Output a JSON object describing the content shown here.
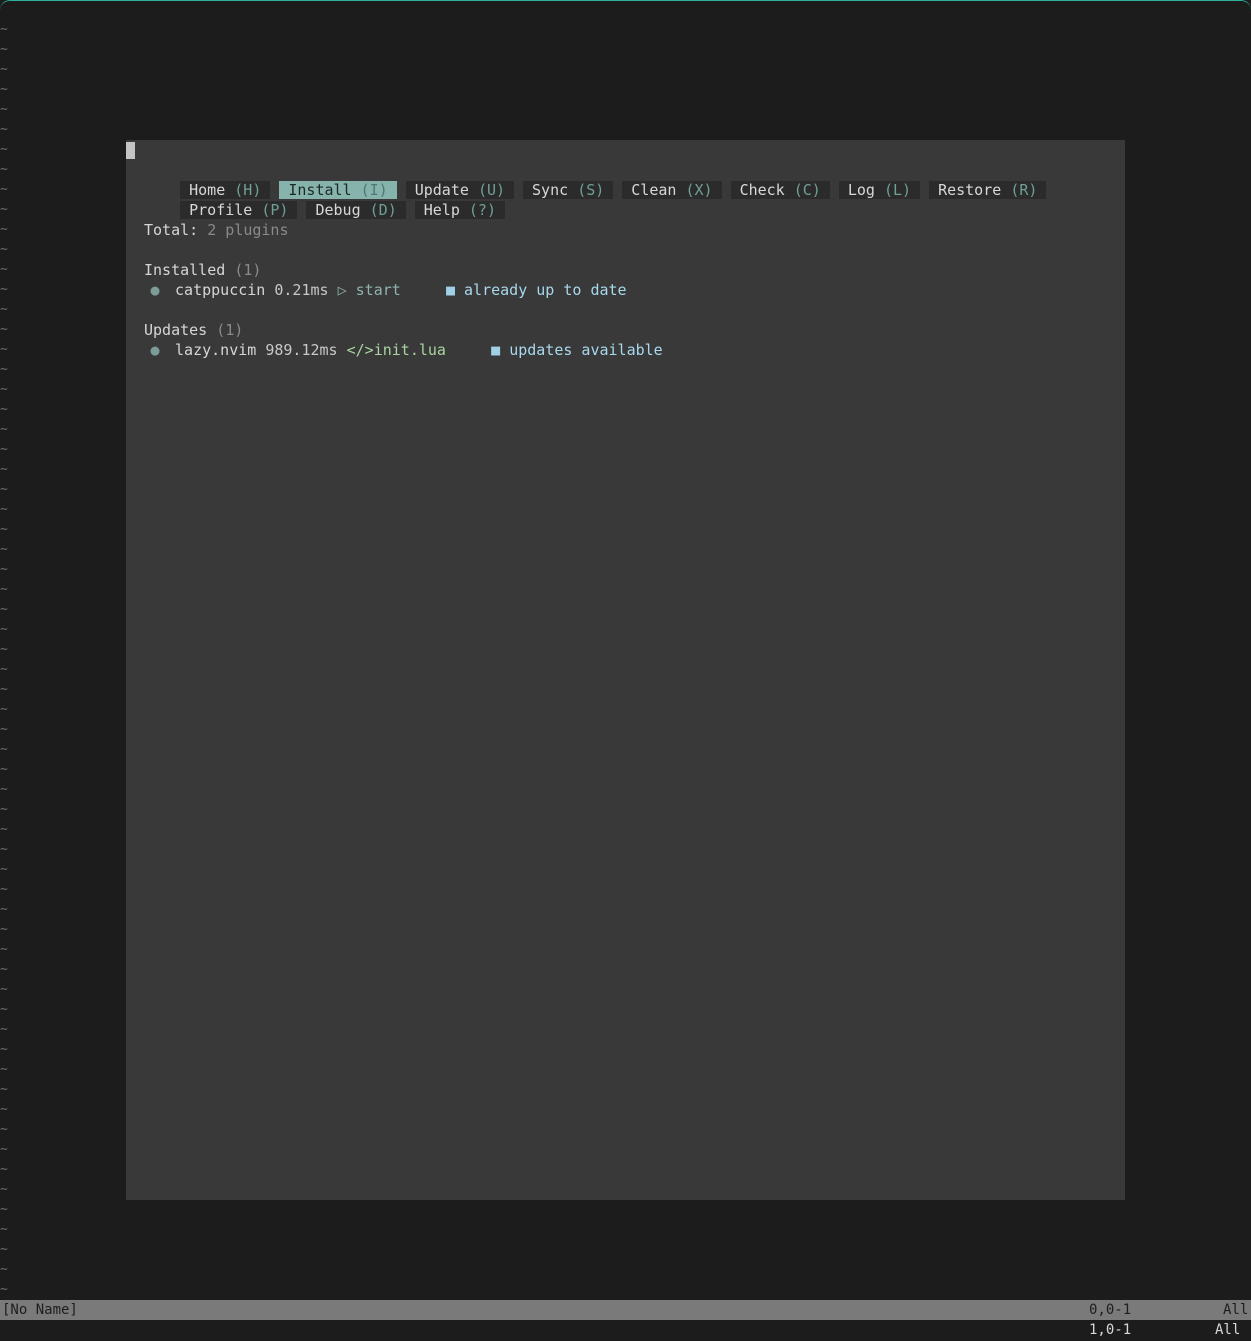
{
  "tilde_char": "~",
  "tabs": [
    {
      "label": "Home",
      "key": "(H)"
    },
    {
      "label": "Install",
      "key": "(I)",
      "active": true
    },
    {
      "label": "Update",
      "key": "(U)"
    },
    {
      "label": "Sync",
      "key": "(S)"
    },
    {
      "label": "Clean",
      "key": "(X)"
    },
    {
      "label": "Check",
      "key": "(C)"
    },
    {
      "label": "Log",
      "key": "(L)"
    },
    {
      "label": "Restore",
      "key": "(R)"
    },
    {
      "label": "Profile",
      "key": "(P)"
    },
    {
      "label": "Debug",
      "key": "(D)"
    },
    {
      "label": "Help",
      "key": "(?)"
    }
  ],
  "summary": {
    "label": "Total:",
    "value": "2 plugins"
  },
  "installed": {
    "title": "Installed",
    "count": "(1)",
    "plugin": {
      "bullet": "●",
      "name": "catppuccin",
      "time": "0.21ms",
      "source_icon": "▷",
      "source": "start",
      "status_icon": "■",
      "status": "already up to date"
    }
  },
  "updates": {
    "title": "Updates",
    "count": "(1)",
    "plugin": {
      "bullet": "●",
      "name": "lazy.nvim",
      "time": "989.12ms",
      "source_icon": "</>",
      "source": "init.lua",
      "status_icon": "■",
      "status": "updates available"
    }
  },
  "statusline": {
    "filename": "[No Name]",
    "position": "0,0-1",
    "scroll": "All"
  },
  "cmdline": {
    "position": "1,0-1",
    "scroll": "All"
  }
}
